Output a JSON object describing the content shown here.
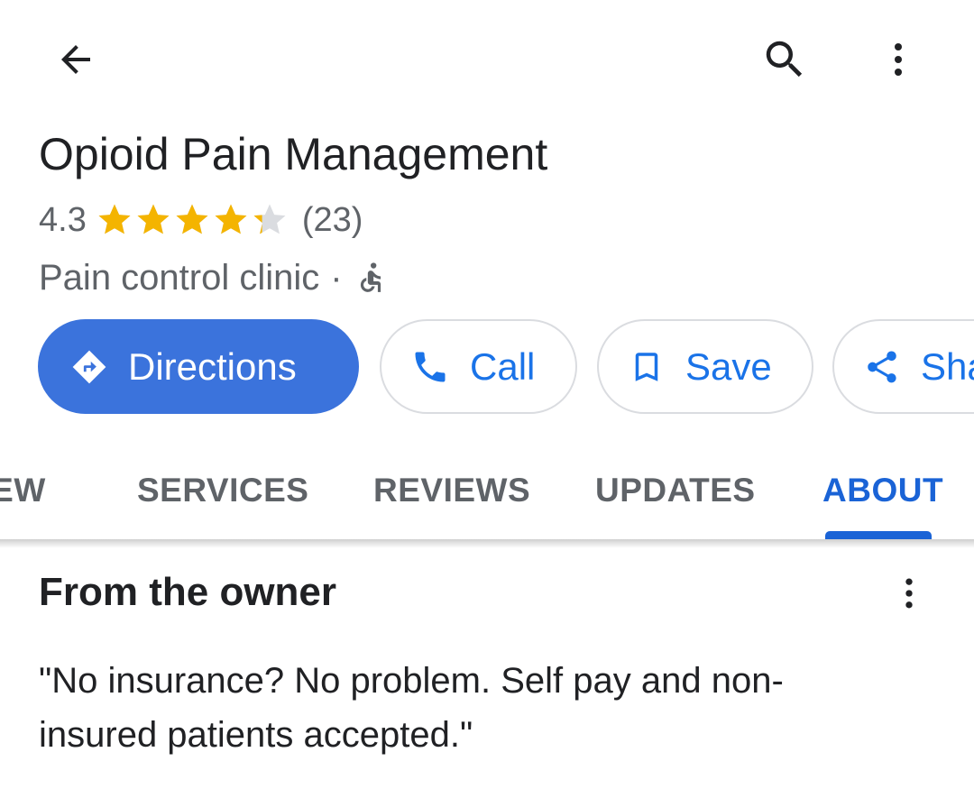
{
  "top_bar": {
    "back_icon": "arrow-back-icon",
    "search_icon": "search-icon",
    "more_icon": "more-vert-icon"
  },
  "place": {
    "name": "Opioid Pain Management",
    "rating": "4.3",
    "rating_value": 4.3,
    "reviews_count": "(23)",
    "category": "Pain control clinic",
    "separator": "·",
    "accessibility_icon": "wheelchair-accessible-icon"
  },
  "actions": [
    {
      "label": "Directions",
      "icon": "directions-icon"
    },
    {
      "label": "Call",
      "icon": "phone-icon"
    },
    {
      "label": "Save",
      "icon": "bookmark-icon"
    },
    {
      "label": "Share",
      "icon": "share-icon"
    }
  ],
  "tabs": [
    {
      "label": "OVERVIEW",
      "selected": false
    },
    {
      "label": "SERVICES",
      "selected": false
    },
    {
      "label": "REVIEWS",
      "selected": false
    },
    {
      "label": "UPDATES",
      "selected": false
    },
    {
      "label": "ABOUT",
      "selected": true
    }
  ],
  "owner_section": {
    "title": "From the owner",
    "more_icon": "more-vert-icon",
    "text": "\"No insurance? No problem. Self pay and non-insured patients accepted.\""
  },
  "colors": {
    "accent": "#1a73e8",
    "directions_button": "#3b73dc",
    "star": "#f4b400",
    "star_empty": "#dadce0",
    "muted_text": "#5f6368"
  }
}
